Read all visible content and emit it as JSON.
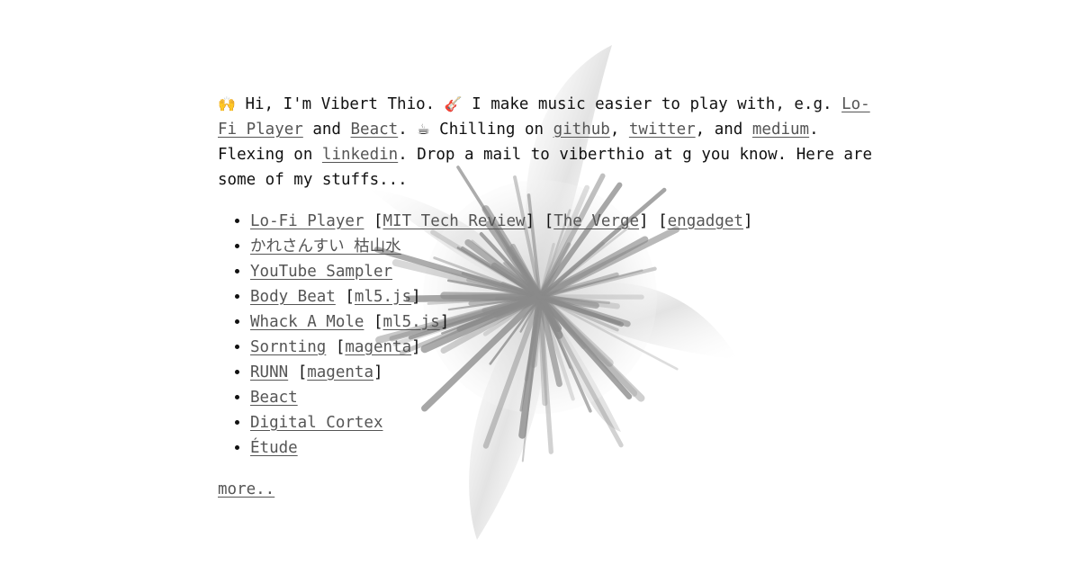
{
  "intro": {
    "wave_emoji": "🙌",
    "greeting": " Hi, I'm Vibert Thio. ",
    "guitar_emoji": "🎸",
    "make_text": " I make music easier to play with, e.g. ",
    "link_lofi": "Lo-Fi Player",
    "and1": " and ",
    "link_beact": "Beact",
    "period1": ". ",
    "coffee_emoji": "☕",
    "chilling_text": " Chilling on ",
    "link_github": "github",
    "comma1": ", ",
    "link_twitter": "twitter",
    "and2": ", and ",
    "link_medium": "medium",
    "flexing_text": ". Flexing on ",
    "link_linkedin": "linkedin",
    "tail_text": ". Drop a mail to viberthio at g you know. Here are some of my stuffs..."
  },
  "projects": [
    {
      "name": "Lo-Fi Player",
      "refs": [
        "MIT Tech Review",
        "The Verge",
        "engadget"
      ]
    },
    {
      "name": "かれさんすい 枯山水",
      "refs": []
    },
    {
      "name": "YouTube Sampler",
      "refs": []
    },
    {
      "name": "Body Beat",
      "refs": [
        "ml5.js"
      ]
    },
    {
      "name": "Whack A Mole",
      "refs": [
        "ml5.js"
      ]
    },
    {
      "name": "Sornting",
      "refs": [
        "magenta"
      ]
    },
    {
      "name": "RUNN",
      "refs": [
        "magenta"
      ]
    },
    {
      "name": "Beact",
      "refs": []
    },
    {
      "name": "Digital Cortex",
      "refs": []
    },
    {
      "name": "Étude",
      "refs": []
    }
  ],
  "more_link": "more..",
  "background": {
    "art": "grayscale-flower-burst",
    "color": "#ffffff",
    "text_color": "#111111",
    "link_color": "#555555"
  }
}
